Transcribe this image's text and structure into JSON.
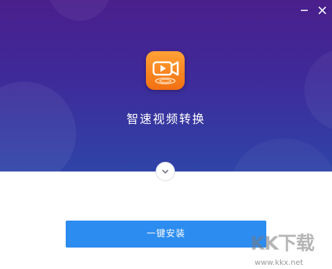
{
  "window": {
    "minimize_icon": "minimize-icon",
    "close_icon": "close-icon"
  },
  "app": {
    "title": "智速视频转换",
    "logo_icon": "video-camera-icon"
  },
  "actions": {
    "expand_icon": "chevron-down-icon",
    "install_label": "一键安装"
  },
  "watermark": {
    "logo_text": "KK下载",
    "url": "www.kkx.net"
  },
  "colors": {
    "hero_top": "#4a1f8c",
    "hero_bottom": "#2f44a8",
    "primary_button": "#2d8cf0",
    "logo_orange": "#f26f12"
  }
}
